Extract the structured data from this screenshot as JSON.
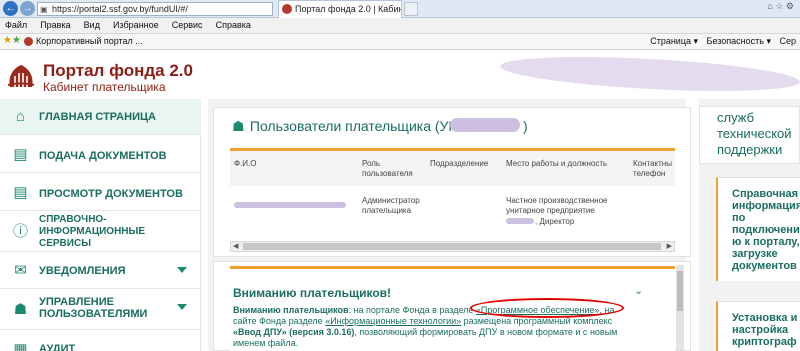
{
  "browser": {
    "url": "https://portal2.ssf.gov.by/fundUI/#/",
    "tab_title": "Портал фонда 2.0 | Кабине...",
    "menu": [
      "Файл",
      "Правка",
      "Вид",
      "Избранное",
      "Сервис",
      "Справка"
    ],
    "favorite_link": "Корпоративный портал ...",
    "commands": [
      "Страница ▾",
      "Безопасность ▾",
      "Сер"
    ]
  },
  "header": {
    "title": "Портал фонда 2.0",
    "subtitle": "Кабинет плательщика"
  },
  "sidebar": {
    "items": [
      {
        "label": "ГЛАВНАЯ СТРАНИЦА",
        "icon": "home-icon"
      },
      {
        "label": "ПОДАЧА ДОКУМЕНТОВ",
        "icon": "document-icon"
      },
      {
        "label": "ПРОСМОТР ДОКУМЕНТОВ",
        "icon": "document-icon"
      },
      {
        "label": "СПРАВОЧНО-\nИНФОРМАЦИОННЫЕ\nСЕРВИСЫ",
        "icon": "info-icon"
      },
      {
        "label": "УВЕДОМЛЕНИЯ",
        "icon": "envelope-icon"
      },
      {
        "label": "УПРАВЛЕНИЕ\nПОЛЬЗОВАТЕЛЯМИ",
        "icon": "users-icon"
      },
      {
        "label": "АУДИТ",
        "icon": "audit-icon"
      }
    ]
  },
  "users_card": {
    "title": "Пользователи плательщика (УНПФ",
    "title_end": ")",
    "columns": [
      "Ф.И.О",
      "Роль\nпользователя",
      "Подразделение",
      "Место работы и должность",
      "Контактны\nтелефон"
    ],
    "row": {
      "role": "Администратор\nплательщика",
      "workplace": "Частное производственное\nунитарное предприятие",
      "position": ", Директор"
    }
  },
  "notice": {
    "title": "Вниманию плательщиков!",
    "p1_bold": "Вниманию плательщиков",
    "p1_a": ": на портале Фонда в разделе ",
    "p1_link1": "«Программное обеспечение»",
    "p1_b": ", на сайте Фонда разделе ",
    "p1_link2": "«Информационные технологии»",
    "p1_c": " размещена программный комплекс ",
    "p1_bold2": "«Ввод ДПУ» (версия 3.0.16)",
    "p1_d": ", позволяющий формировать ДПУ в новом формате и с новым именем файла."
  },
  "right_panel": {
    "heading": "служб\nтехнической\nподдержки",
    "cards": [
      "Справочная\nинформация\nпо\nподключени\nю к порталу,\nзагрузке\nдокументов",
      "Установка и\nнастройка\nкриптограф"
    ]
  }
}
